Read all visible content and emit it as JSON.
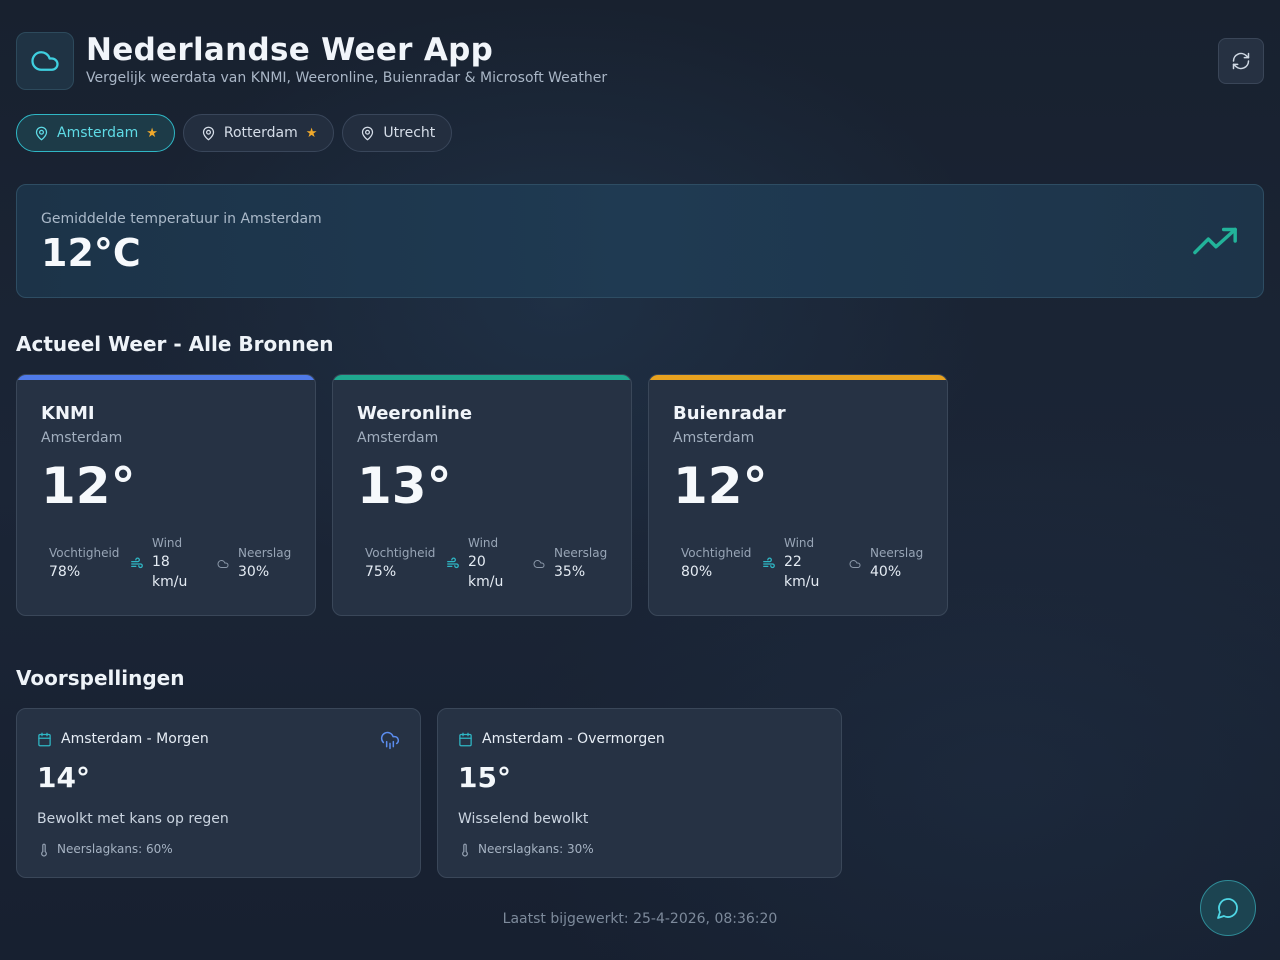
{
  "header": {
    "title": "Nederlandse Weer App",
    "subtitle": "Vergelijk weerdata van KNMI, Weeronline, Buienradar & Microsoft Weather"
  },
  "cities": [
    {
      "name": "Amsterdam",
      "favorite": true,
      "active": true
    },
    {
      "name": "Rotterdam",
      "favorite": true,
      "active": false
    },
    {
      "name": "Utrecht",
      "favorite": false,
      "active": false
    }
  ],
  "average": {
    "label": "Gemiddelde temperatuur in Amsterdam",
    "value": "12°C"
  },
  "current_section_title": "Actueel Weer - Alle Bronnen",
  "sources": [
    {
      "name": "KNMI",
      "city": "Amsterdam",
      "temp": "12°",
      "accent": "#4f7ae8",
      "humidity_label": "Vochtigheid",
      "humidity": "78%",
      "wind_label": "Wind",
      "wind_value": "18",
      "wind_unit": "km/u",
      "rain_label": "Neerslag",
      "rain": "30%"
    },
    {
      "name": "Weeronline",
      "city": "Amsterdam",
      "temp": "13°",
      "accent": "#1fa88f",
      "humidity_label": "Vochtigheid",
      "humidity": "75%",
      "wind_label": "Wind",
      "wind_value": "20",
      "wind_unit": "km/u",
      "rain_label": "Neerslag",
      "rain": "35%"
    },
    {
      "name": "Buienradar",
      "city": "Amsterdam",
      "temp": "12°",
      "accent": "#e8a21f",
      "humidity_label": "Vochtigheid",
      "humidity": "80%",
      "wind_label": "Wind",
      "wind_value": "22",
      "wind_unit": "km/u",
      "rain_label": "Neerslag",
      "rain": "40%"
    }
  ],
  "forecast_section_title": "Voorspellingen",
  "forecasts": [
    {
      "title": "Amsterdam - Morgen",
      "temp": "14°",
      "description": "Bewolkt met kans op regen",
      "rain": "Neerslagkans: 60%",
      "icon": "cloud-rain-icon"
    },
    {
      "title": "Amsterdam - Overmorgen",
      "temp": "15°",
      "description": "Wisselend bewolkt",
      "rain": "Neerslagkans: 30%",
      "icon": ""
    }
  ],
  "footer": "Laatst bijgewerkt: 25-4-2026, 08:36:20",
  "colors": {
    "accent": "#2fb7c5",
    "star": "#f0a92b",
    "trend": "#22b39a"
  }
}
